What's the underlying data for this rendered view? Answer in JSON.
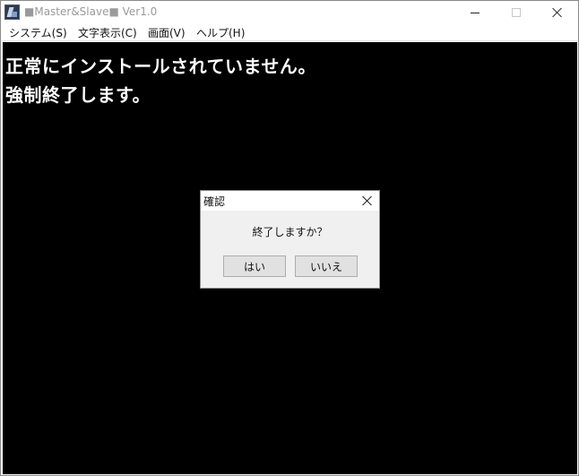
{
  "window": {
    "title": "■Master&Slave■ Ver1.0",
    "icons": {
      "app": "app-icon",
      "minimize": "minimize-icon",
      "maximize": "maximize-icon",
      "close": "close-icon"
    }
  },
  "menubar": {
    "items": [
      {
        "label": "システム(S)"
      },
      {
        "label": "文字表示(C)"
      },
      {
        "label": "画面(V)"
      },
      {
        "label": "ヘルプ(H)"
      }
    ]
  },
  "content": {
    "lines": [
      "正常にインストールされていません。",
      "強制終了します。"
    ]
  },
  "dialog": {
    "title": "確認",
    "message": "終了しますか？",
    "yes_label": "はい",
    "no_label": "いいえ"
  },
  "colors": {
    "client_background": "#000000",
    "message_text": "#ffffff",
    "dialog_background": "#f0f0f0",
    "button_background": "#e1e1e1"
  }
}
